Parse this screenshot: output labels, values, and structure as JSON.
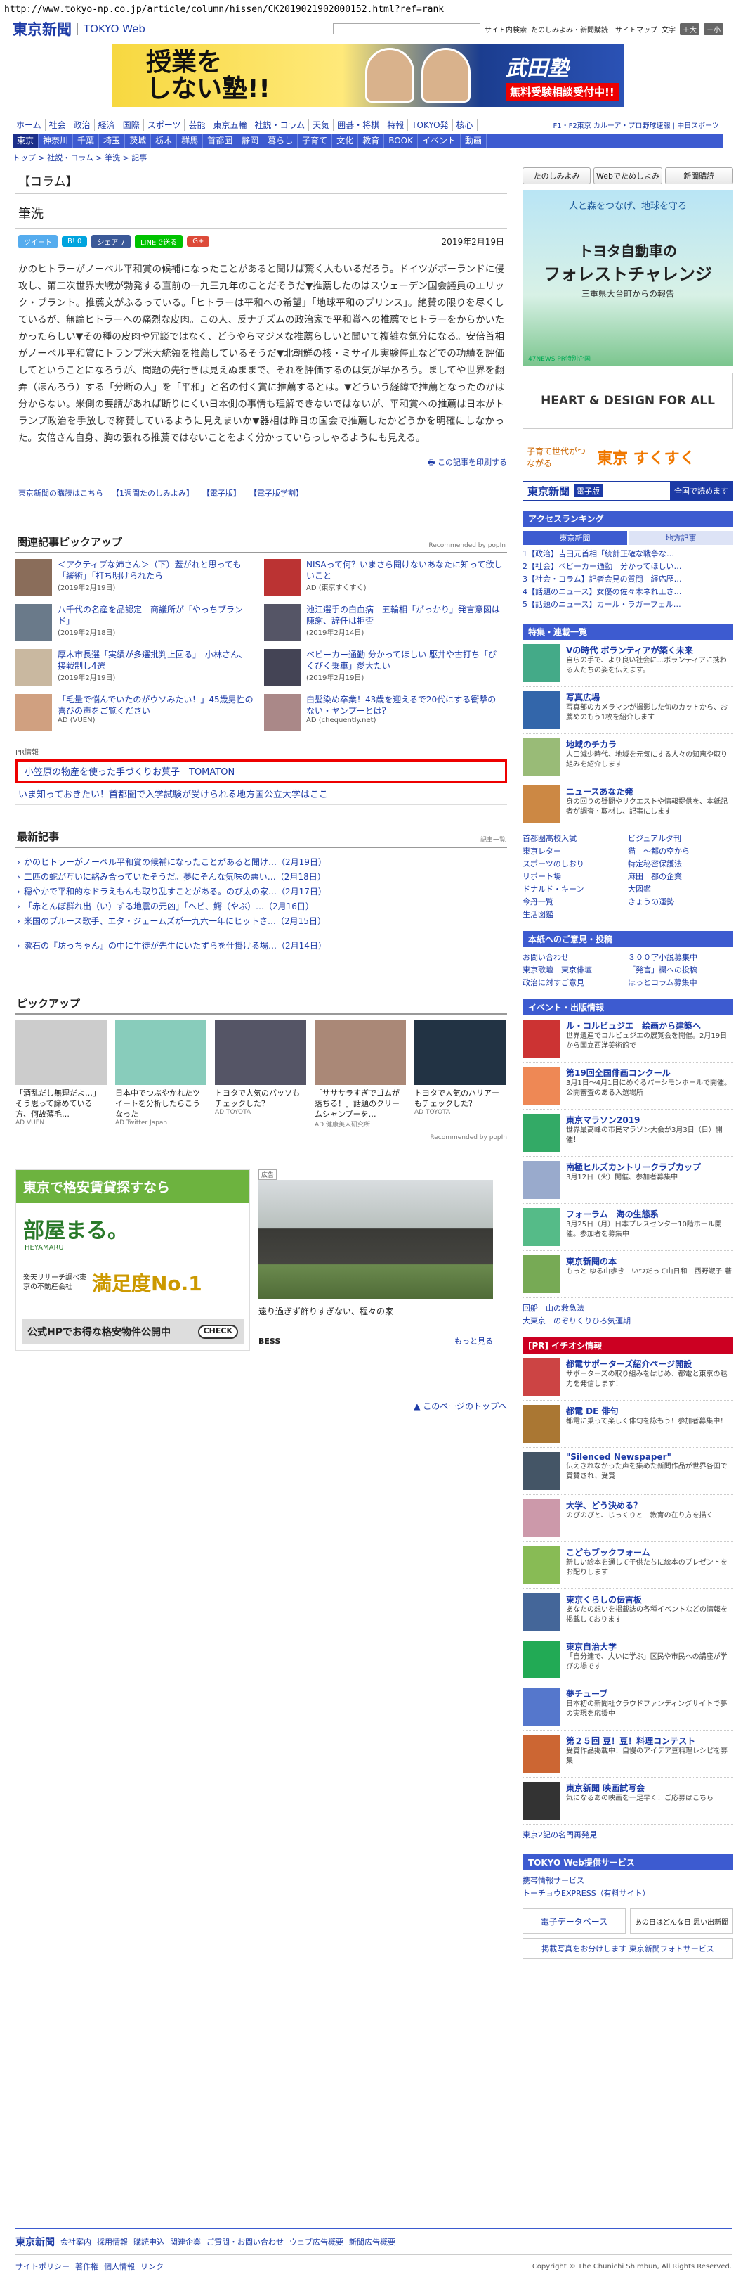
{
  "url": "http://www.tokyo-np.co.jp/article/column/hissen/CK2019021902000152.html?ref=rank",
  "header": {
    "logo": "東京新聞",
    "web": "TOKYO Web",
    "search_tail": "サイト内検索",
    "links": "たのしみよみ・新聞購読　サイトマップ",
    "size": "文字",
    "plus": "＋大",
    "minus": "－小"
  },
  "banner": {
    "line1": "授業を",
    "line2": "しない塾!!",
    "brand": "武田塾",
    "cta": "無料受験相談受付中!!"
  },
  "nav1": [
    "ホーム",
    "社会",
    "政治",
    "経済",
    "国際",
    "スポーツ",
    "芸能",
    "東京五輪",
    "社説・コラム",
    "天気",
    "囲碁・将棋",
    "特報",
    "TOKYO発",
    "核心"
  ],
  "nav1_right": "F1・F2東京 カルーア・プロ野球速報 | 中日スポーツ",
  "nav2": [
    "東京",
    "神奈川",
    "千葉",
    "埼玉",
    "茨城",
    "栃木",
    "群馬",
    "首都圏",
    "静岡",
    "暮らし",
    "子育て",
    "文化",
    "教育",
    "BOOK",
    "イベント",
    "動画"
  ],
  "crumb": "トップ > 社説・コラム > 筆洗 > 記事",
  "column_label": "【コラム】",
  "title": "筆洗",
  "share": [
    "ツイート",
    "B! 0",
    "シェア 7",
    "LINEで送る",
    "G+"
  ],
  "date": "2019年2月19日",
  "body": "かのヒトラーがノーベル平和賞の候補になったことがあると聞けば驚く人もいるだろう。ドイツがポーランドに侵攻し、第二次世界大戦が勃発する直前の一九三九年のことだそうだ▼推薦したのはスウェーデン国会議員のエリック・ブラント。推薦文がふるっている。「ヒトラーは平和への希望」「地球平和のプリンス」。絶賛の限りを尽くしているが、無論ヒトラーへの痛烈な皮肉。この人、反ナチズムの政治家で平和賞への推薦でヒトラーをからかいたかったらしい▼その種の皮肉や冗談ではなく、どうやらマジメな推薦らしいと聞いて複雑な気分になる。安倍首相がノーベル平和賞にトランプ米大統領を推薦しているそうだ▼北朝鮮の核・ミサイル実験停止などでの功績を評価してということになろうが、問題の先行きは見えぬままで、それを評価するのは気が早かろう。ましてや世界を翻弄（ほんろう）する「分断の人」を「平和」と名の付く賞に推薦するとは。▼どういう経緯で推薦となったのかは分からない。米側の要請があれば断りにくい日本側の事情も理解できないではないが、平和賞への推薦は日本がトランプ政治を手放しで称賛しているように見えまいか▼器相は昨日の国会で推薦したかどうかを明確にしなかった。安倍さん自身、胸の張れる推薦ではないことをよく分かっていらっしゃるようにも見える。",
  "print": "この記事を印刷する",
  "links": [
    "東京新聞の購読はこちら",
    "【1週間たのしみよみ】",
    "【電子版】",
    "【電子版学割】"
  ],
  "related": {
    "title": "関連記事ピックアップ",
    "rec": "Recommended by popIn",
    "items": [
      {
        "t": "＜アクティブな姉さん＞（下）蓋がれと思っても「緩術」「打ち明けられたら",
        "d": "(2019年2月19日)"
      },
      {
        "t": "NISAって何？いまさら聞けないあなたに知って欲しいこと",
        "d": "AD (東京すくすく)"
      },
      {
        "t": "八千代の名産を品認定　商議所が「やっちブランド」",
        "d": "(2019年2月18日)"
      },
      {
        "t": "池江選手の白血病　五輪相「がっかり」発言意図は陳謝、辞任は拒否",
        "d": "(2019年2月14日)"
      },
      {
        "t": "厚木市長選「実績が多選批判上回る」　小林さん、接戦制し4選",
        "d": "(2019年2月19日)"
      },
      {
        "t": "ベビーカー通勤 分かってほしい 駆井や古打ち「びくびく乗車」愛大たい",
        "d": "(2019年2月19日)"
      },
      {
        "t": "「毛量で悩んでいたのがウソみたい！」45歳男性の喜びの声をご覧ください",
        "d": "AD (VUEN)"
      },
      {
        "t": "白髪染め卒業！43歳を迎えるで20代にする衝撃のない・ヤンプーとは？",
        "d": "AD (chequently.net)"
      }
    ]
  },
  "pr": {
    "label": "PR情報",
    "item1": "小笠原の物産を使った手づくりお菓子　TOMATON",
    "item2": "いま知っておきたい！首都圏で入学試験が受けられる地方国公立大学はここ"
  },
  "latest": {
    "title": "最新記事",
    "more": "記事一覧",
    "items": [
      "かのヒトラーがノーベル平和賞の候補になったことがあると聞け…（2月19日）",
      "二匹の蛇が互いに絡み合っていたそうだ。夢にそんな気味の悪い…（2月18日）",
      "穏やかで平和的なドラえもんも取り乱すことがある。のび太の家…（2月17日）",
      "「赤とんぼ群れ出（い）ずる地震の元凶」「へビ、鰐（やぶ）…（2月16日）",
      "米国のブルース歌手、エタ・ジェームズが一九六一年にヒットさ…（2月15日）",
      "漱石の『坊っちゃん』の中に生徒が先生にいたずらを仕掛ける場…（2月14日）"
    ]
  },
  "pickup": {
    "title": "ピックアップ",
    "rec": "Recommended by popIn",
    "items": [
      {
        "t": "「酒乱だし無理だよ…」そう思って諦めている方、何故薄毛…",
        "s": "AD VUEN"
      },
      {
        "t": "日本中でつぶやかれたツイートを分析したらこうなった",
        "s": "AD Twitter Japan"
      },
      {
        "t": "トヨタで人気のバッソもチェックした？",
        "s": "AD TOYOTA"
      },
      {
        "t": "「サササラすぎでゴムが落ちる！」話題のクリームシャンプーを…",
        "s": "AD 健康美人研究所"
      },
      {
        "t": "トヨタで人気のハリアーもチェックした？",
        "s": "AD TOYOTA"
      }
    ]
  },
  "ad1": {
    "head": "東京で格安賃貸探すなら",
    "brand": "部屋まる。",
    "brand_en": "HEYAMARU",
    "rank": "楽天リサーチ調べ東京の不動産会社",
    "score": "満足度No.1",
    "cta": "公式HPでお得な格安物件公開中",
    "check": "CHECK"
  },
  "ad2": {
    "badge": "広告",
    "caption": "遠り過ぎず飾りすぎない、程々の家",
    "brand": "BESS",
    "more": "もっと見る"
  },
  "totop": "このページのトップへ",
  "side": {
    "btns": [
      "たのしみよみ",
      "Webでためしよみ",
      "新聞購読"
    ],
    "toyota": {
      "top": "人と森をつなげ、地球を守る",
      "l1": "トヨタ自動車の",
      "l2": "フォレストチャレンジ",
      "l3": "三重県大台町からの報告",
      "foot": "47NEWS PR特別企画"
    },
    "hd": "HEART & DESIGN FOR ALL",
    "kosodate": {
      "pre": "子育て世代がつながる",
      "brand": "東京 すくすく"
    },
    "eshinbun": {
      "a": "東京新聞",
      "b": "電子版",
      "c": "全国で読めます"
    },
    "rank": {
      "title": "アクセスランキング",
      "tabs": [
        "東京新聞",
        "地方記事"
      ],
      "items": [
        "1【政治】吉田元首相「統計正確な戦争な…",
        "2【社会】ベビーカー通勤　分かってほしい…",
        "3【社会・コラム】記者会見の質問　経応歴…",
        "4【話題のニュース】女優の佐々木ネれ工さ…",
        "5【話題のニュース】カール・ラガーフェル…"
      ]
    },
    "special": {
      "title": "特集・連載一覧",
      "items": [
        {
          "t": "Vの時代 ボランティアが築く未来",
          "d": "自らの手で、より良い社会に…ボランティアに携わる人たちの姿を伝えます。"
        },
        {
          "t": "写真広場",
          "d": "写真部のカメラマンが撮影した旬のカットから、お薦めのもう1枚を紹介します"
        },
        {
          "t": "地域のチカラ",
          "d": "人口減少時代、地域を元気にする人々の知恵や取り組みを紹介します"
        },
        {
          "t": "ニュースあなた発",
          "d": "身の回りの疑問やリクエストや情報提供を、本紙記者が調査・取材し、記事にします"
        }
      ]
    },
    "cats": [
      "首都圏高校入試",
      "ビジュアルタ刊",
      "東京レター",
      "猫　～都の空から",
      "スポーツのしおり",
      "特定秘密保護法",
      "リポート場",
      "麻田　都の企業",
      "ドナルド・キーン",
      "大図鑑",
      "今丹一覧",
      "きょうの運勢",
      "生活図鑑"
    ],
    "op": {
      "title": "本紙へのご意見・投稿",
      "items": [
        "お問い合わせ",
        "３００字小説募集中",
        "東京歌壇　東京俳壇",
        "「発言」欄への投稿",
        "政治に対すご意見",
        "ほっとコラム募集中"
      ]
    },
    "ev": {
      "title": "イベント・出版情報",
      "items": [
        {
          "t": "ル・コルビュジエ　絵画から建築へ",
          "d": "世界遺産でコルビュジエの展覧会を開催。2月19日から国立西洋美術館で"
        },
        {
          "t": "第19回全国俳画コンクール",
          "d": "3月1日～4月1日にめぐるパーシモンホールで開催。公開審査のある入選場所"
        },
        {
          "t": "東京マラソン2019",
          "d": "世界最高峰の市民マラソン大会が3月3日（日）開催！"
        },
        {
          "t": "南極ヒルズカントリークラブカップ",
          "d": "3月12日（火）開催、参加者募集中"
        },
        {
          "t": "フォーラム　海の生態系",
          "d": "3月25日（月）日本プレスセンター10階ホール開催。参加者を募集中"
        },
        {
          "t": "東京新聞の本",
          "d": "もっと ゆる山歩き　いつだって山日和　西野淑子 著"
        }
      ],
      "more": [
        "回船　山の救急法",
        "大東京　のぞりくりひろ気運期"
      ]
    },
    "pr": {
      "title": "[PR] イチオシ情報",
      "items": [
        {
          "t": "都電サポーターズ紹介ページ開設",
          "d": "サポーターズの取り組みをはじめ、都電と東京の魅力を発信します！"
        },
        {
          "t": "都電 DE 俳句",
          "d": "都電に乗って楽しく俳句を詠もう！参加者募集中！"
        },
        {
          "t": "\"Silenced Newspaper\"",
          "d": "伝えきれなかった声を集めた新聞作品が世界各国で賞賛され、受賞"
        },
        {
          "t": "大学、どう決める？",
          "d": "のびのびと、じっくりと　教育の在り方を描く"
        },
        {
          "t": "こどもブックフォーム",
          "d": "新しい絵本を通して子供たちに絵本のプレゼントをお配りします"
        },
        {
          "t": "東京くらしの伝言板",
          "d": "あなたの想いを掲載誌の各種イベントなどの情報を掲載しております"
        },
        {
          "t": "東京自治大学",
          "d": "「自分達で、大いに学ぶ」区民や市民への講座が学びの場です"
        },
        {
          "t": "夢チューブ",
          "d": "日本初の新聞社クラウドファンディングサイトで夢の実現を応援中"
        },
        {
          "t": "第２５回 豆！豆！料理コンテスト",
          "d": "受賞作品掲載中！自慢のアイデア豆料理レシピを募集"
        },
        {
          "t": "東京新聞 映画試写会",
          "d": "気になるあの映画を一足早く！ご応募はこちら"
        }
      ],
      "more": "東京2記の名門再発見"
    },
    "svc": {
      "title": "TOKYO Web提供サービス",
      "items": [
        "携帯情報サービス",
        "トーチョウEXPRESS（有料サイト）"
      ]
    },
    "bottom": [
      "電子データベース",
      "あの日はどんな日 思い出新聞",
      "掲載写真をお分けします 東京新聞フォトサービス"
    ]
  },
  "footer": {
    "logo": "東京新聞",
    "links": [
      "会社案内",
      "採用情報",
      "購読申込",
      "関連企業",
      "ご質問・お問い合わせ",
      "ウェブ広告概要",
      "新聞広告概要"
    ],
    "links2": [
      "サイトポリシー",
      "著作権",
      "個人情報",
      "リンク"
    ],
    "copy": "Copyright © The Chunichi Shimbun, All Rights Reserved."
  },
  "colors": {
    "accent": "#3d5bd0",
    "navy": "#1c3aa6",
    "pr_red": "#e00000"
  }
}
